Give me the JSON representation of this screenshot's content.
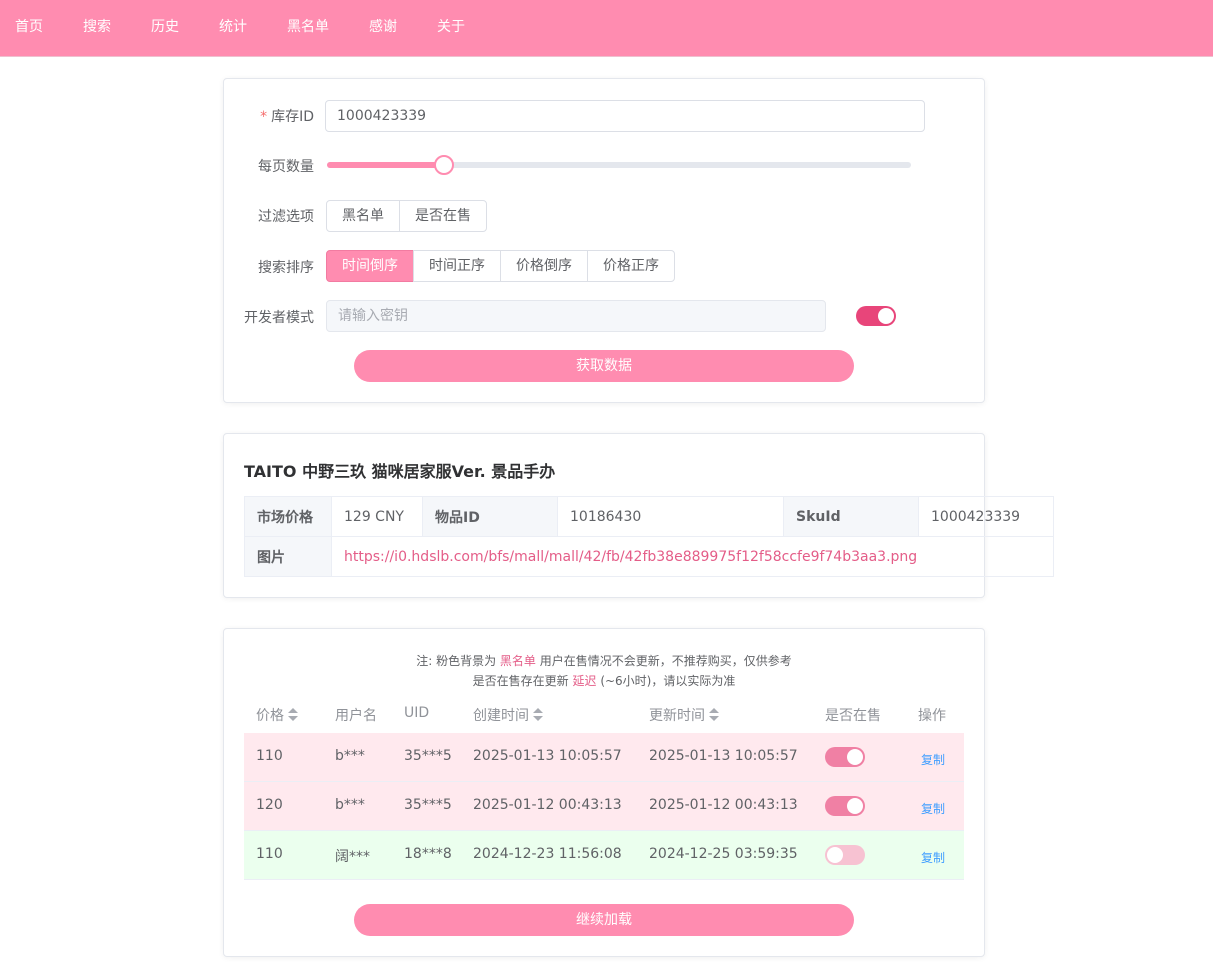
{
  "nav": {
    "items": [
      "首页",
      "搜索",
      "历史",
      "统计",
      "黑名单",
      "感谢",
      "关于"
    ]
  },
  "form": {
    "inventory_id_label": "库存ID",
    "inventory_id_required_mark": "*",
    "inventory_id_value": "1000423339",
    "per_page_label": "每页数量",
    "per_page_level": 0.2,
    "filter_label": "过滤选项",
    "filter_options": [
      "黑名单",
      "是否在售"
    ],
    "sort_label": "搜索排序",
    "sort_options": [
      "时间倒序",
      "时间正序",
      "价格倒序",
      "价格正序"
    ],
    "sort_active": "时间倒序",
    "dev_mode_label": "开发者模式",
    "dev_key_placeholder": "请输入密钥",
    "dev_mode_on": true,
    "fetch_button": "获取数据"
  },
  "item": {
    "title": "TAITO 中野三玖 猫咪居家服Ver. 景品手办",
    "market_price_label": "市场价格",
    "market_price": "129 CNY",
    "item_id_label": "物品ID",
    "item_id": "10186430",
    "skuid_label": "SkuId",
    "skuid": "1000423339",
    "image_label": "图片",
    "image_url": "https://i0.hdslb.com/bfs/mall/mall/42/fb/42fb38e889975f12f58ccfe9f74b3aa3.png"
  },
  "notes": {
    "line1_prefix": "注: 粉色背景为",
    "line1_highlight": "黑名单",
    "line1_suffix": "用户在售情况不会更新，不推荐购买，仅供参考",
    "line2_prefix": "是否在售存在更新",
    "line2_highlight": "延迟",
    "line2_suffix": "(~6小时)，请以实际为准"
  },
  "results": {
    "headers": {
      "price": "价格",
      "username": "用户名",
      "uid": "UID",
      "created": "创建时间",
      "updated": "更新时间",
      "on_sale": "是否在售",
      "action": "操作"
    },
    "rows": [
      {
        "price": "110",
        "username": "b***",
        "uid": "35***5",
        "created": "2025-01-13 10:05:57",
        "updated": "2025-01-13 10:05:57",
        "on_sale": true,
        "action": "复制",
        "row_style": "pink"
      },
      {
        "price": "120",
        "username": "b***",
        "uid": "35***5",
        "created": "2025-01-12 00:43:13",
        "updated": "2025-01-12 00:43:13",
        "on_sale": true,
        "action": "复制",
        "row_style": "pink"
      },
      {
        "price": "110",
        "username": "阔***",
        "uid": "18***8",
        "created": "2024-12-23 11:56:08",
        "updated": "2024-12-25 03:59:35",
        "on_sale": false,
        "action": "复制",
        "row_style": "green"
      }
    ],
    "load_more_button": "继续加载"
  },
  "colors": {
    "accent": "#ff8cb0",
    "switch_on": "#f080a4",
    "switch_off": "#f7c2d2",
    "dev_switch": "#e8457a",
    "link": "#e45d88",
    "blacklist_row": "#ffe9ee",
    "normal_row": "#ebffee",
    "copy_link": "#409eff"
  }
}
